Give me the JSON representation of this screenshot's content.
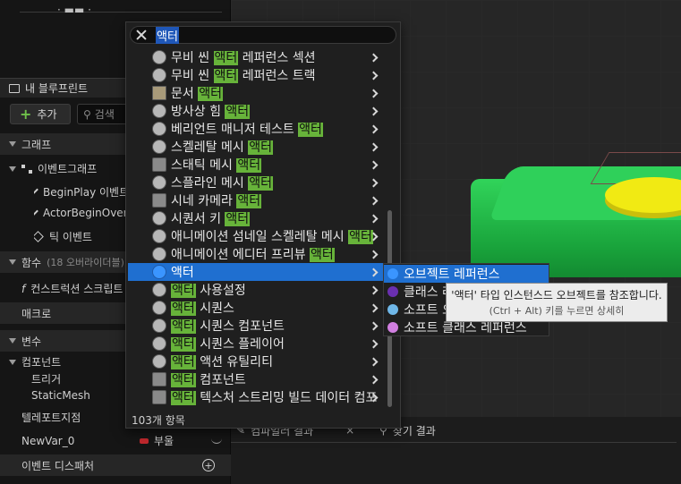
{
  "left_panel": {
    "top_stub_text": "· ▬▬ ·",
    "tab_label": "내 블루프린트",
    "add_label": "추가",
    "search_placeholder": "검색",
    "sections": {
      "graph": "그래프",
      "functions": "함수",
      "functions_sub": "(18 오버라이더블)",
      "macros": "매크로",
      "variables": "변수",
      "dispatchers": "이벤트 디스패처"
    },
    "graph_items": {
      "event_graph": "이벤트그래프",
      "events": [
        "BeginPlay 이벤트",
        "ActorBeginOverlap",
        "틱 이벤트"
      ]
    },
    "construction_script": "컨스트럭션 스크립트",
    "components_label": "컴포넌트",
    "components": [
      "트리거",
      "StaticMesh"
    ],
    "teleport_label": "텔레포트지점",
    "newvar": {
      "name": "NewVar_0",
      "type": "부울"
    }
  },
  "bottom_tabs": {
    "compiler_results": "컴파일러 결과",
    "find_results": "찾기 결과"
  },
  "action_menu": {
    "search_value": "액터",
    "items": [
      {
        "pre": "무비 씬 ",
        "hl": "액터",
        "post": " 레퍼런스 섹션",
        "icon": "circle"
      },
      {
        "pre": "무비 씬 ",
        "hl": "액터",
        "post": " 레퍼런스 트랙",
        "icon": "circle"
      },
      {
        "pre": "문서 ",
        "hl": "액터",
        "post": "",
        "icon": "doc"
      },
      {
        "pre": "방사상 힘 ",
        "hl": "액터",
        "post": "",
        "icon": "circle"
      },
      {
        "pre": "베리언트 매니저 테스트 ",
        "hl": "액터",
        "post": "",
        "icon": "circle"
      },
      {
        "pre": "스켈레탈 메시 ",
        "hl": "액터",
        "post": "",
        "icon": "circle"
      },
      {
        "pre": "스태틱 메시 ",
        "hl": "액터",
        "post": "",
        "icon": "cube"
      },
      {
        "pre": "스플라인 메시 ",
        "hl": "액터",
        "post": "",
        "icon": "circle"
      },
      {
        "pre": "시네 카메라 ",
        "hl": "액터",
        "post": "",
        "icon": "cube"
      },
      {
        "pre": "시퀀서 키 ",
        "hl": "액터",
        "post": "",
        "icon": "circle"
      },
      {
        "pre": "애니메이션 섬네일 스켈레탈 메시 ",
        "hl": "액터",
        "post": "",
        "icon": "circle"
      },
      {
        "pre": "애니메이션 에디터 프리뷰 ",
        "hl": "액터",
        "post": "",
        "icon": "circle"
      },
      {
        "pre": "",
        "hl": "액터",
        "post": "",
        "icon": "circle",
        "selected": true
      },
      {
        "pre": "",
        "hl": "액터",
        "post": " 사용설정",
        "icon": "circle"
      },
      {
        "pre": "",
        "hl": "액터",
        "post": " 시퀀스",
        "icon": "circle"
      },
      {
        "pre": "",
        "hl": "액터",
        "post": " 시퀀스 컴포넌트",
        "icon": "circle"
      },
      {
        "pre": "",
        "hl": "액터",
        "post": " 시퀀스 플레이어",
        "icon": "circle"
      },
      {
        "pre": "",
        "hl": "액터",
        "post": " 액션 유틸리티",
        "icon": "circle"
      },
      {
        "pre": "",
        "hl": "액터",
        "post": " 컴포넌트",
        "icon": "cube"
      },
      {
        "pre": "",
        "hl": "액터",
        "post": " 텍스처 스트리밍 빌드 데이터 컴포",
        "icon": "cube"
      }
    ],
    "footer": "103개 항목",
    "colors": {
      "highlight": "#67b33a",
      "selection": "#1f6fd0"
    }
  },
  "submenu": {
    "items": [
      {
        "label": "오브젝트 레퍼런스",
        "color": "#3a95ff",
        "selected": true
      },
      {
        "label": "클래스 레퍼런스",
        "color": "#6a2fb0"
      },
      {
        "label": "소프트 오브젝트 레퍼런스",
        "color": "#6fb7e8"
      },
      {
        "label": "소프트 클래스 레퍼런스",
        "color": "#d17fe0"
      }
    ]
  },
  "tooltip": {
    "line1": "'액터' 타입 인스턴스드 오브젝트를 참조합니다.",
    "line2": "(Ctrl + Alt) 키를 누르면 상세히"
  }
}
